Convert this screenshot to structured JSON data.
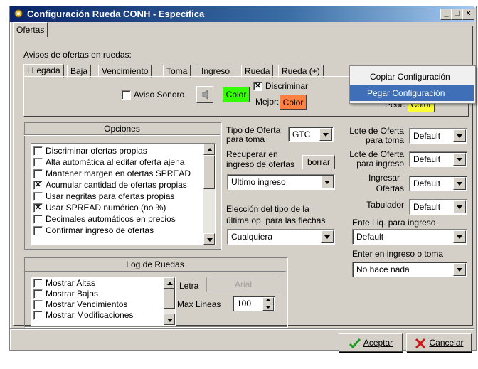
{
  "window": {
    "title": "Configuración Rueda CONH - Específica"
  },
  "top_tab": "Ofertas",
  "avisos": {
    "label": "Avisos de ofertas en ruedas:",
    "tabs": [
      "LLegada",
      "Baja",
      "Vencimiento",
      "Toma",
      "Ingreso",
      "Rueda",
      "Rueda (+)"
    ],
    "aviso_sonoro": "Aviso Sonoro",
    "color_button": "Color",
    "discriminar": "Discriminar",
    "mejor": "Mejor:",
    "peor": "Peor:",
    "color_mejor": "Color",
    "color_peor": "Color",
    "colors": {
      "green": "#33ff00",
      "orange": "#ff8040",
      "yellow": "#ffff33"
    }
  },
  "context_menu": {
    "items": [
      "Copiar Configuración",
      "Pegar Configuración"
    ],
    "selected_index": 1
  },
  "opciones": {
    "title": "Opciones",
    "items": [
      {
        "label": "Discriminar ofertas propias",
        "checked": false
      },
      {
        "label": "Alta automática al editar oferta ajena",
        "checked": false
      },
      {
        "label": "Mantener margen en ofertas SPREAD",
        "checked": false
      },
      {
        "label": "Acumular cantidad de ofertas propias",
        "checked": true
      },
      {
        "label": "Usar negritas para ofertas propias",
        "checked": false
      },
      {
        "label": "Usar SPREAD numérico (no %)",
        "checked": true
      },
      {
        "label": "Decimales automáticos en precios",
        "checked": false
      },
      {
        "label": "Confirmar ingreso de ofertas",
        "checked": false
      }
    ]
  },
  "middle": {
    "tipo_oferta_label1": "Tipo de Oferta",
    "tipo_oferta_label2": "para toma",
    "tipo_oferta_value": "GTC",
    "recuperar_label1": "Recuperar en",
    "recuperar_label2": "ingreso de ofertas",
    "borrar": "borrar",
    "recuperar_value": "Ultimo ingreso",
    "eleccion_label1": "Elección del tipo de la",
    "eleccion_label2": "última op. para las flechas",
    "eleccion_value": "Cualquiera"
  },
  "right": {
    "lote_toma_label1": "Lote de Oferta",
    "lote_toma_label2": "para toma",
    "lote_toma_value": "Default",
    "lote_ingreso_label1": "Lote de Oferta",
    "lote_ingreso_label2": "para ingreso",
    "lote_ingreso_value": "Default",
    "ingresar_label1": "Ingresar",
    "ingresar_label2": "Ofertas",
    "ingresar_value": "Default",
    "tabulador_label": "Tabulador",
    "tabulador_value": "Default",
    "ente_label": "Ente Liq. para ingreso",
    "ente_value": "Default",
    "enter_label": "Enter en ingreso o toma",
    "enter_value": "No hace nada"
  },
  "log": {
    "title": "Log de Ruedas",
    "items": [
      {
        "label": "Mostrar Altas",
        "checked": false
      },
      {
        "label": "Mostrar Bajas",
        "checked": false
      },
      {
        "label": "Mostrar Vencimientos",
        "checked": false
      },
      {
        "label": "Mostrar Modificaciones",
        "checked": false
      }
    ],
    "letra_label": "Letra",
    "letra_value": "Arial",
    "max_lineas_label": "Max Lineas",
    "max_lineas_value": "100"
  },
  "footer": {
    "aceptar": "Aceptar",
    "cancelar": "Cancelar"
  }
}
